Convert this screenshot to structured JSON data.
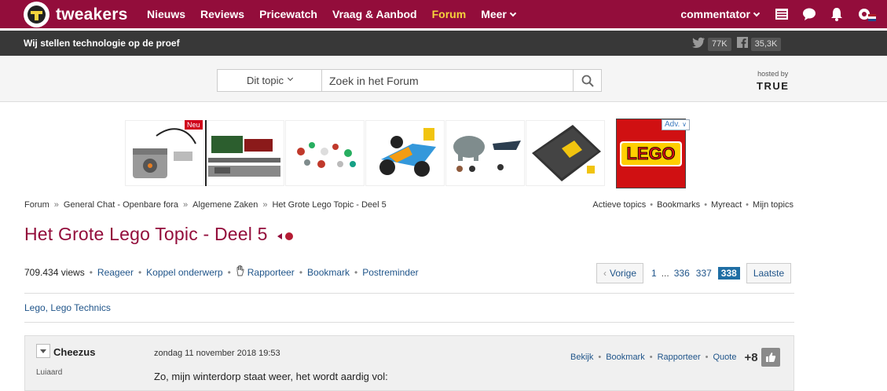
{
  "site": {
    "logo_text": "tweakers",
    "slogan": "Wij stellen technologie op de proef"
  },
  "nav": {
    "items": [
      "Nieuws",
      "Reviews",
      "Pricewatch",
      "Vraag & Aanbod",
      "Forum",
      "Meer"
    ],
    "active": "Forum",
    "user": "commentator"
  },
  "social": {
    "twitter_count": "77K",
    "facebook_count": "35,3K"
  },
  "search": {
    "scope": "Dit topic",
    "placeholder": "Zoek in het Forum",
    "hosted_label": "hosted by",
    "hosted_brand": "TRUE"
  },
  "ads": {
    "badge": "Neu",
    "adv_label": "Adv.",
    "brand": "LEGO"
  },
  "breadcrumb": [
    "Forum",
    "General Chat - Openbare fora",
    "Algemene Zaken",
    "Het Grote Lego Topic - Deel 5"
  ],
  "quicklinks": [
    "Actieve topics",
    "Bookmarks",
    "Myreact",
    "Mijn topics"
  ],
  "topic": {
    "title": "Het Grote Lego Topic - Deel 5",
    "views": "709.434 views",
    "actions": [
      "Reageer",
      "Koppel onderwerp",
      "Rapporteer",
      "Bookmark",
      "Postreminder"
    ],
    "tags": "Lego, Lego Technics"
  },
  "pager": {
    "prev": "Vorige",
    "first": "1",
    "ellipsis": "...",
    "pages": [
      "336",
      "337"
    ],
    "current": "338",
    "last": "Laatste"
  },
  "post": {
    "author": "Cheezus",
    "rank": "Luiaard",
    "date": "zondag 11 november 2018 19:53",
    "actions": [
      "Bekijk",
      "Bookmark",
      "Rapporteer",
      "Quote"
    ],
    "score": "+8",
    "body": "Zo, mijn winterdorp staat weer, het wordt aardig vol:"
  },
  "colors": {
    "brand": "#930d3b",
    "accent": "#f5d33c",
    "link": "#20558a",
    "pager_current": "#1f6ea4"
  }
}
